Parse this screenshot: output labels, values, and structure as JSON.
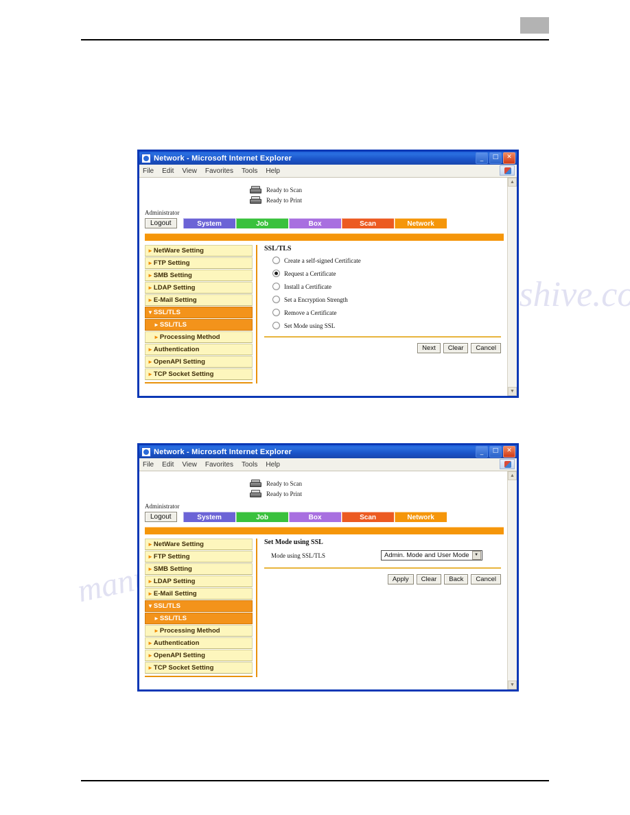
{
  "window_title": "Network - Microsoft Internet Explorer",
  "menu_items": [
    "File",
    "Edit",
    "View",
    "Favorites",
    "Tools",
    "Help"
  ],
  "titlebar_buttons": {
    "minimize": "_",
    "maximize": "□",
    "close": "✕"
  },
  "status": {
    "scan": "Ready to Scan",
    "print": "Ready to Print"
  },
  "admin_label": "Administrator",
  "logout_label": "Logout",
  "tabs": [
    {
      "label": "System",
      "color": "#6b63d6"
    },
    {
      "label": "Job",
      "color": "#39c13d"
    },
    {
      "label": "Box",
      "color": "#a86fe0"
    },
    {
      "label": "Scan",
      "color": "#ec5a21"
    },
    {
      "label": "Network",
      "color": "#f5960a"
    }
  ],
  "sidebar": {
    "items": [
      {
        "label": "NetWare Setting",
        "arrow": "►",
        "active": false,
        "level": 0
      },
      {
        "label": "FTP Setting",
        "arrow": "►",
        "active": false,
        "level": 0
      },
      {
        "label": "SMB Setting",
        "arrow": "►",
        "active": false,
        "level": 0
      },
      {
        "label": "LDAP Setting",
        "arrow": "►",
        "active": false,
        "level": 0
      },
      {
        "label": "E-Mail Setting",
        "arrow": "►",
        "active": false,
        "level": 0
      },
      {
        "label": "SSL/TLS",
        "arrow": "▼",
        "active": true,
        "level": 0
      },
      {
        "label": "SSL/TLS",
        "arrow": "►",
        "active": true,
        "level": 1
      },
      {
        "label": "Processing Method",
        "arrow": "►",
        "active": false,
        "level": 1
      },
      {
        "label": "Authentication",
        "arrow": "►",
        "active": false,
        "level": 0
      },
      {
        "label": "OpenAPI Setting",
        "arrow": "►",
        "active": false,
        "level": 0
      },
      {
        "label": "TCP Socket Setting",
        "arrow": "►",
        "active": false,
        "level": 0
      }
    ]
  },
  "window_one": {
    "content_title": "SSL/TLS",
    "options": [
      {
        "label": "Create a self-signed Certificate",
        "checked": false
      },
      {
        "label": "Request a Certificate",
        "checked": true
      },
      {
        "label": "Install a Certificate",
        "checked": false
      },
      {
        "label": "Set a Encryption Strength",
        "checked": false
      },
      {
        "label": "Remove a Certificate",
        "checked": false
      },
      {
        "label": "Set Mode using SSL",
        "checked": false
      }
    ],
    "buttons": [
      "Next",
      "Clear",
      "Cancel"
    ]
  },
  "window_two": {
    "content_title": "Set Mode using SSL",
    "field_label": "Mode using SSL/TLS",
    "select_value": "Admin. Mode and User Mode",
    "select_arrow": "▼",
    "buttons": [
      "Apply",
      "Clear",
      "Back",
      "Cancel"
    ]
  },
  "scrollbar": {
    "up": "▲",
    "down": "▼"
  },
  "watermark": {
    "line1": "e-manualshive.com",
    "line2": "manualshive.com"
  }
}
